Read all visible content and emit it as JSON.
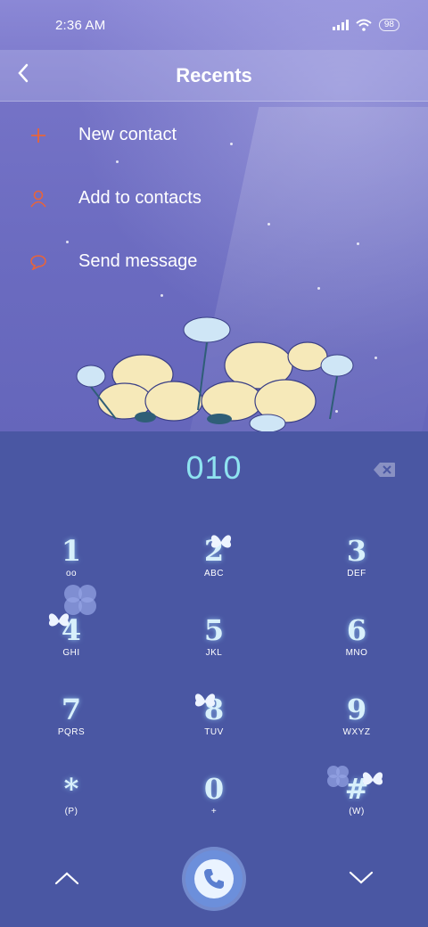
{
  "status": {
    "time": "2:36 AM",
    "battery": "98",
    "icons": [
      "signal-icon",
      "wifi-icon",
      "battery-icon"
    ]
  },
  "header": {
    "title": "Recents",
    "back_icon": "chevron-left-icon"
  },
  "menu": {
    "items": [
      {
        "label": "New contact",
        "icon": "plus-icon"
      },
      {
        "label": "Add to contacts",
        "icon": "person-icon"
      },
      {
        "label": "Send message",
        "icon": "message-icon"
      }
    ]
  },
  "dialer": {
    "number": "010",
    "backspace_icon": "backspace-icon",
    "keys": [
      {
        "digit": "1",
        "letters": "ᴏᴏ"
      },
      {
        "digit": "2",
        "letters": "ABC"
      },
      {
        "digit": "3",
        "letters": "DEF"
      },
      {
        "digit": "4",
        "letters": "GHI"
      },
      {
        "digit": "5",
        "letters": "JKL"
      },
      {
        "digit": "6",
        "letters": "MNO"
      },
      {
        "digit": "7",
        "letters": "PQRS"
      },
      {
        "digit": "8",
        "letters": "TUV"
      },
      {
        "digit": "9",
        "letters": "WXYZ"
      },
      {
        "digit": "*",
        "letters": "(P)"
      },
      {
        "digit": "0",
        "letters": "+"
      },
      {
        "digit": "#",
        "letters": "(W)"
      }
    ]
  },
  "bottom": {
    "up_icon": "chevron-up-icon",
    "call_icon": "phone-icon",
    "down_icon": "chevron-down-icon"
  },
  "colors": {
    "accent_orange": "#e8643a",
    "number_cyan": "#8fe3f0",
    "dialer_bg": "#4a57a3",
    "call_button": "#6c8fdb"
  }
}
